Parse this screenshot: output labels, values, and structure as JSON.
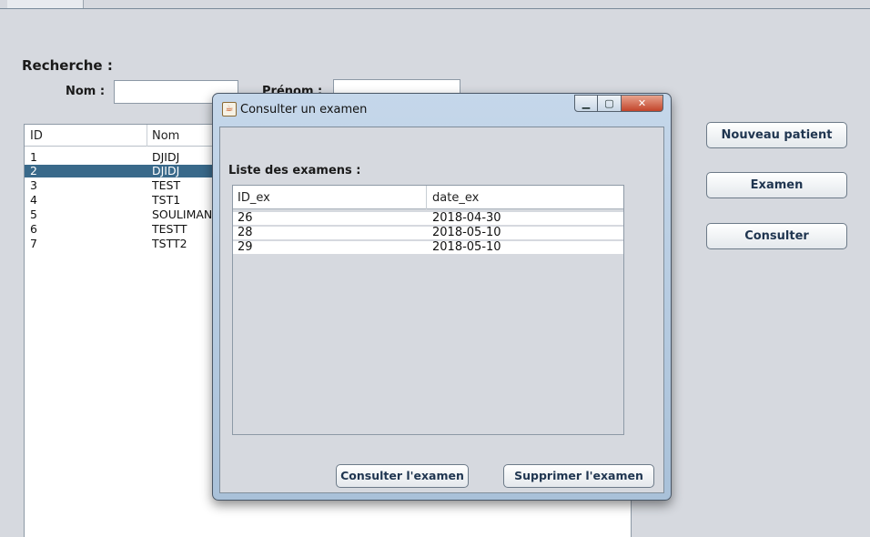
{
  "search": {
    "heading": "Recherche :",
    "nom_label": "Nom :",
    "nom_value": "",
    "prenom_label": "Prénom :",
    "prenom_value": ""
  },
  "patients_table": {
    "columns": [
      "ID",
      "Nom"
    ],
    "rows": [
      {
        "id": "1",
        "nom": "DJIDJ"
      },
      {
        "id": "2",
        "nom": "DJIDJ"
      },
      {
        "id": "3",
        "nom": "TEST"
      },
      {
        "id": "4",
        "nom": "TST1"
      },
      {
        "id": "5",
        "nom": "SOULIMANI"
      },
      {
        "id": "6",
        "nom": "TESTT"
      },
      {
        "id": "7",
        "nom": "TSTT2"
      }
    ],
    "selected_id": "2"
  },
  "actions": {
    "new_patient": "Nouveau patient",
    "exam": "Examen",
    "consult": "Consulter"
  },
  "dialog": {
    "title": "Consulter un examen",
    "app_icon": "java-cup-icon",
    "list_heading": "Liste des examens :",
    "columns": [
      "ID_ex",
      "date_ex"
    ],
    "rows": [
      {
        "id": "26",
        "date": "2018-04-30"
      },
      {
        "id": "28",
        "date": "2018-05-10"
      },
      {
        "id": "29",
        "date": "2018-05-10"
      }
    ],
    "consult_button": "Consulter l'examen",
    "delete_button": "Supprimer l'examen"
  },
  "colors": {
    "window_bg": "#d6d9df",
    "selection": "#39698a",
    "button_text": "#1f3550",
    "close_button": "#c2442a"
  }
}
